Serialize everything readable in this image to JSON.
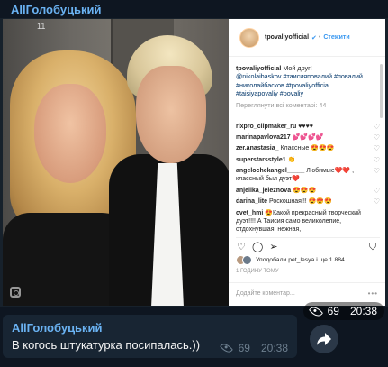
{
  "channel": {
    "title": "AllГолобуцький"
  },
  "post": {
    "instagram": {
      "username": "tpovaliyofficial",
      "follow_label": "Стежити",
      "caption_user": "tpovaliyofficial",
      "caption_text": "Мой друг!",
      "caption_tags": "@nikolaibaskov #таисияповалий #повалий #николайбасков #tpovaliyofficial #taisiyapovaliy #povaliy",
      "view_all": "Переглянути всі коментарі: 44",
      "comments": [
        {
          "user": "rixpro_clipmaker_ru",
          "text": "♥♥♥♥"
        },
        {
          "user": "marinapavlova217",
          "text": "💕💕💕💕"
        },
        {
          "user": "zer.anastasia_",
          "text": "Классные 😍😍😍"
        },
        {
          "user": "superstarsstyle1",
          "text": "👏"
        },
        {
          "user": "angelochekangel_____",
          "text": "Любимые❤️❤️ , классный был дуэт❤️"
        },
        {
          "user": "anjelika_jeleznova",
          "text": "😍😍😍"
        },
        {
          "user": "darina_lite",
          "text": "Роскошная!!! 😍😍😍"
        }
      ],
      "last_comment_user": "cvet_hmi",
      "last_comment_text": "😍Какой прекрасный творческий дуэт!!!! А Таисия само великолепие, отдохнувшая, нежная,",
      "likes_text": "Уподобали pet_lesya і ще 1 884",
      "time": "1 годину тому",
      "add_comment": "Додайте коментар...",
      "more": "•••"
    },
    "views": "69",
    "time": "20:38",
    "photo_label": "11"
  },
  "message": {
    "author": "AllГолобуцький",
    "text": "В когось штукатурка посипалась.))",
    "views": "69",
    "time": "20:38"
  }
}
